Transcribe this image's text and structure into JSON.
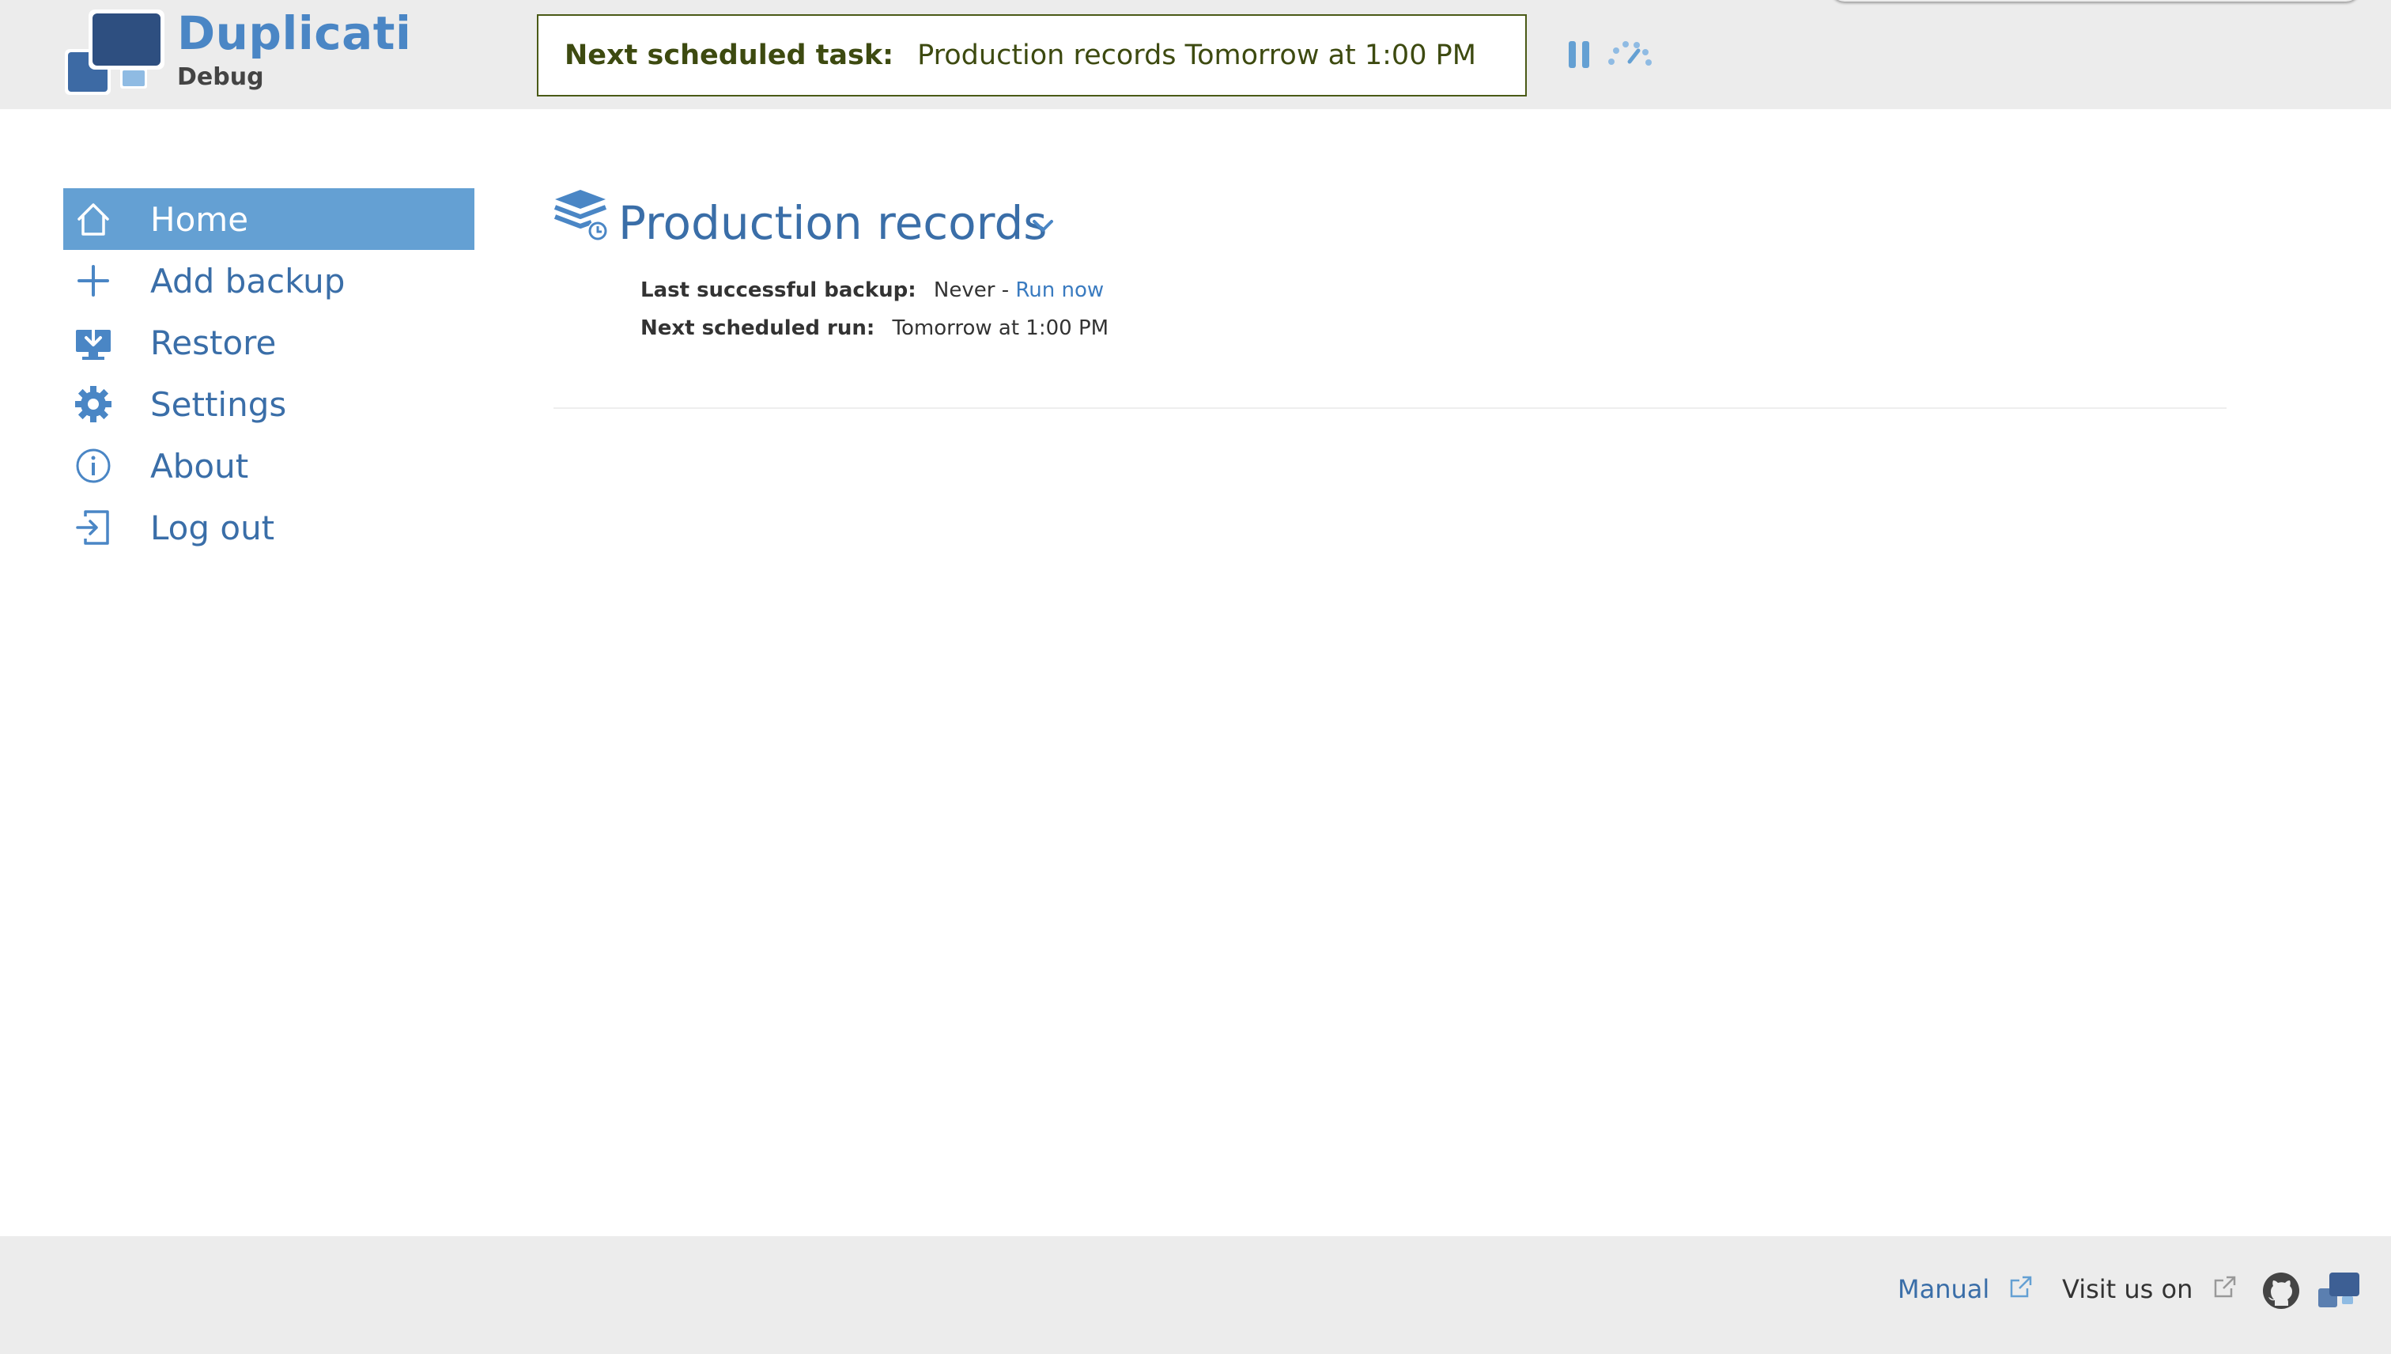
{
  "header": {
    "brand_name": "Duplicati",
    "brand_sub": "Debug",
    "next_task_label": "Next scheduled task:",
    "next_task_value": "Production records Tomorrow at 1:00 PM",
    "pause_icon": "pause-icon",
    "throttle_icon": "throttle-gauge-icon"
  },
  "sidebar": {
    "items": [
      {
        "label": "Home",
        "icon": "home-icon",
        "active": true
      },
      {
        "label": "Add backup",
        "icon": "plus-icon",
        "active": false
      },
      {
        "label": "Restore",
        "icon": "restore-icon",
        "active": false
      },
      {
        "label": "Settings",
        "icon": "gear-icon",
        "active": false
      },
      {
        "label": "About",
        "icon": "info-icon",
        "active": false
      },
      {
        "label": "Log out",
        "icon": "logout-icon",
        "active": false
      }
    ]
  },
  "backup": {
    "title": "Production records",
    "last_backup_label": "Last successful backup:",
    "last_backup_value": "Never -",
    "run_now": "Run now",
    "next_run_label": "Next scheduled run:",
    "next_run_value": "Tomorrow at 1:00 PM"
  },
  "footer": {
    "manual": "Manual",
    "visit": "Visit us on"
  },
  "colors": {
    "accent": "#4a86c5",
    "active_nav": "#64a0d3",
    "header_bg": "#ececec",
    "task_border": "#4a5a16"
  }
}
